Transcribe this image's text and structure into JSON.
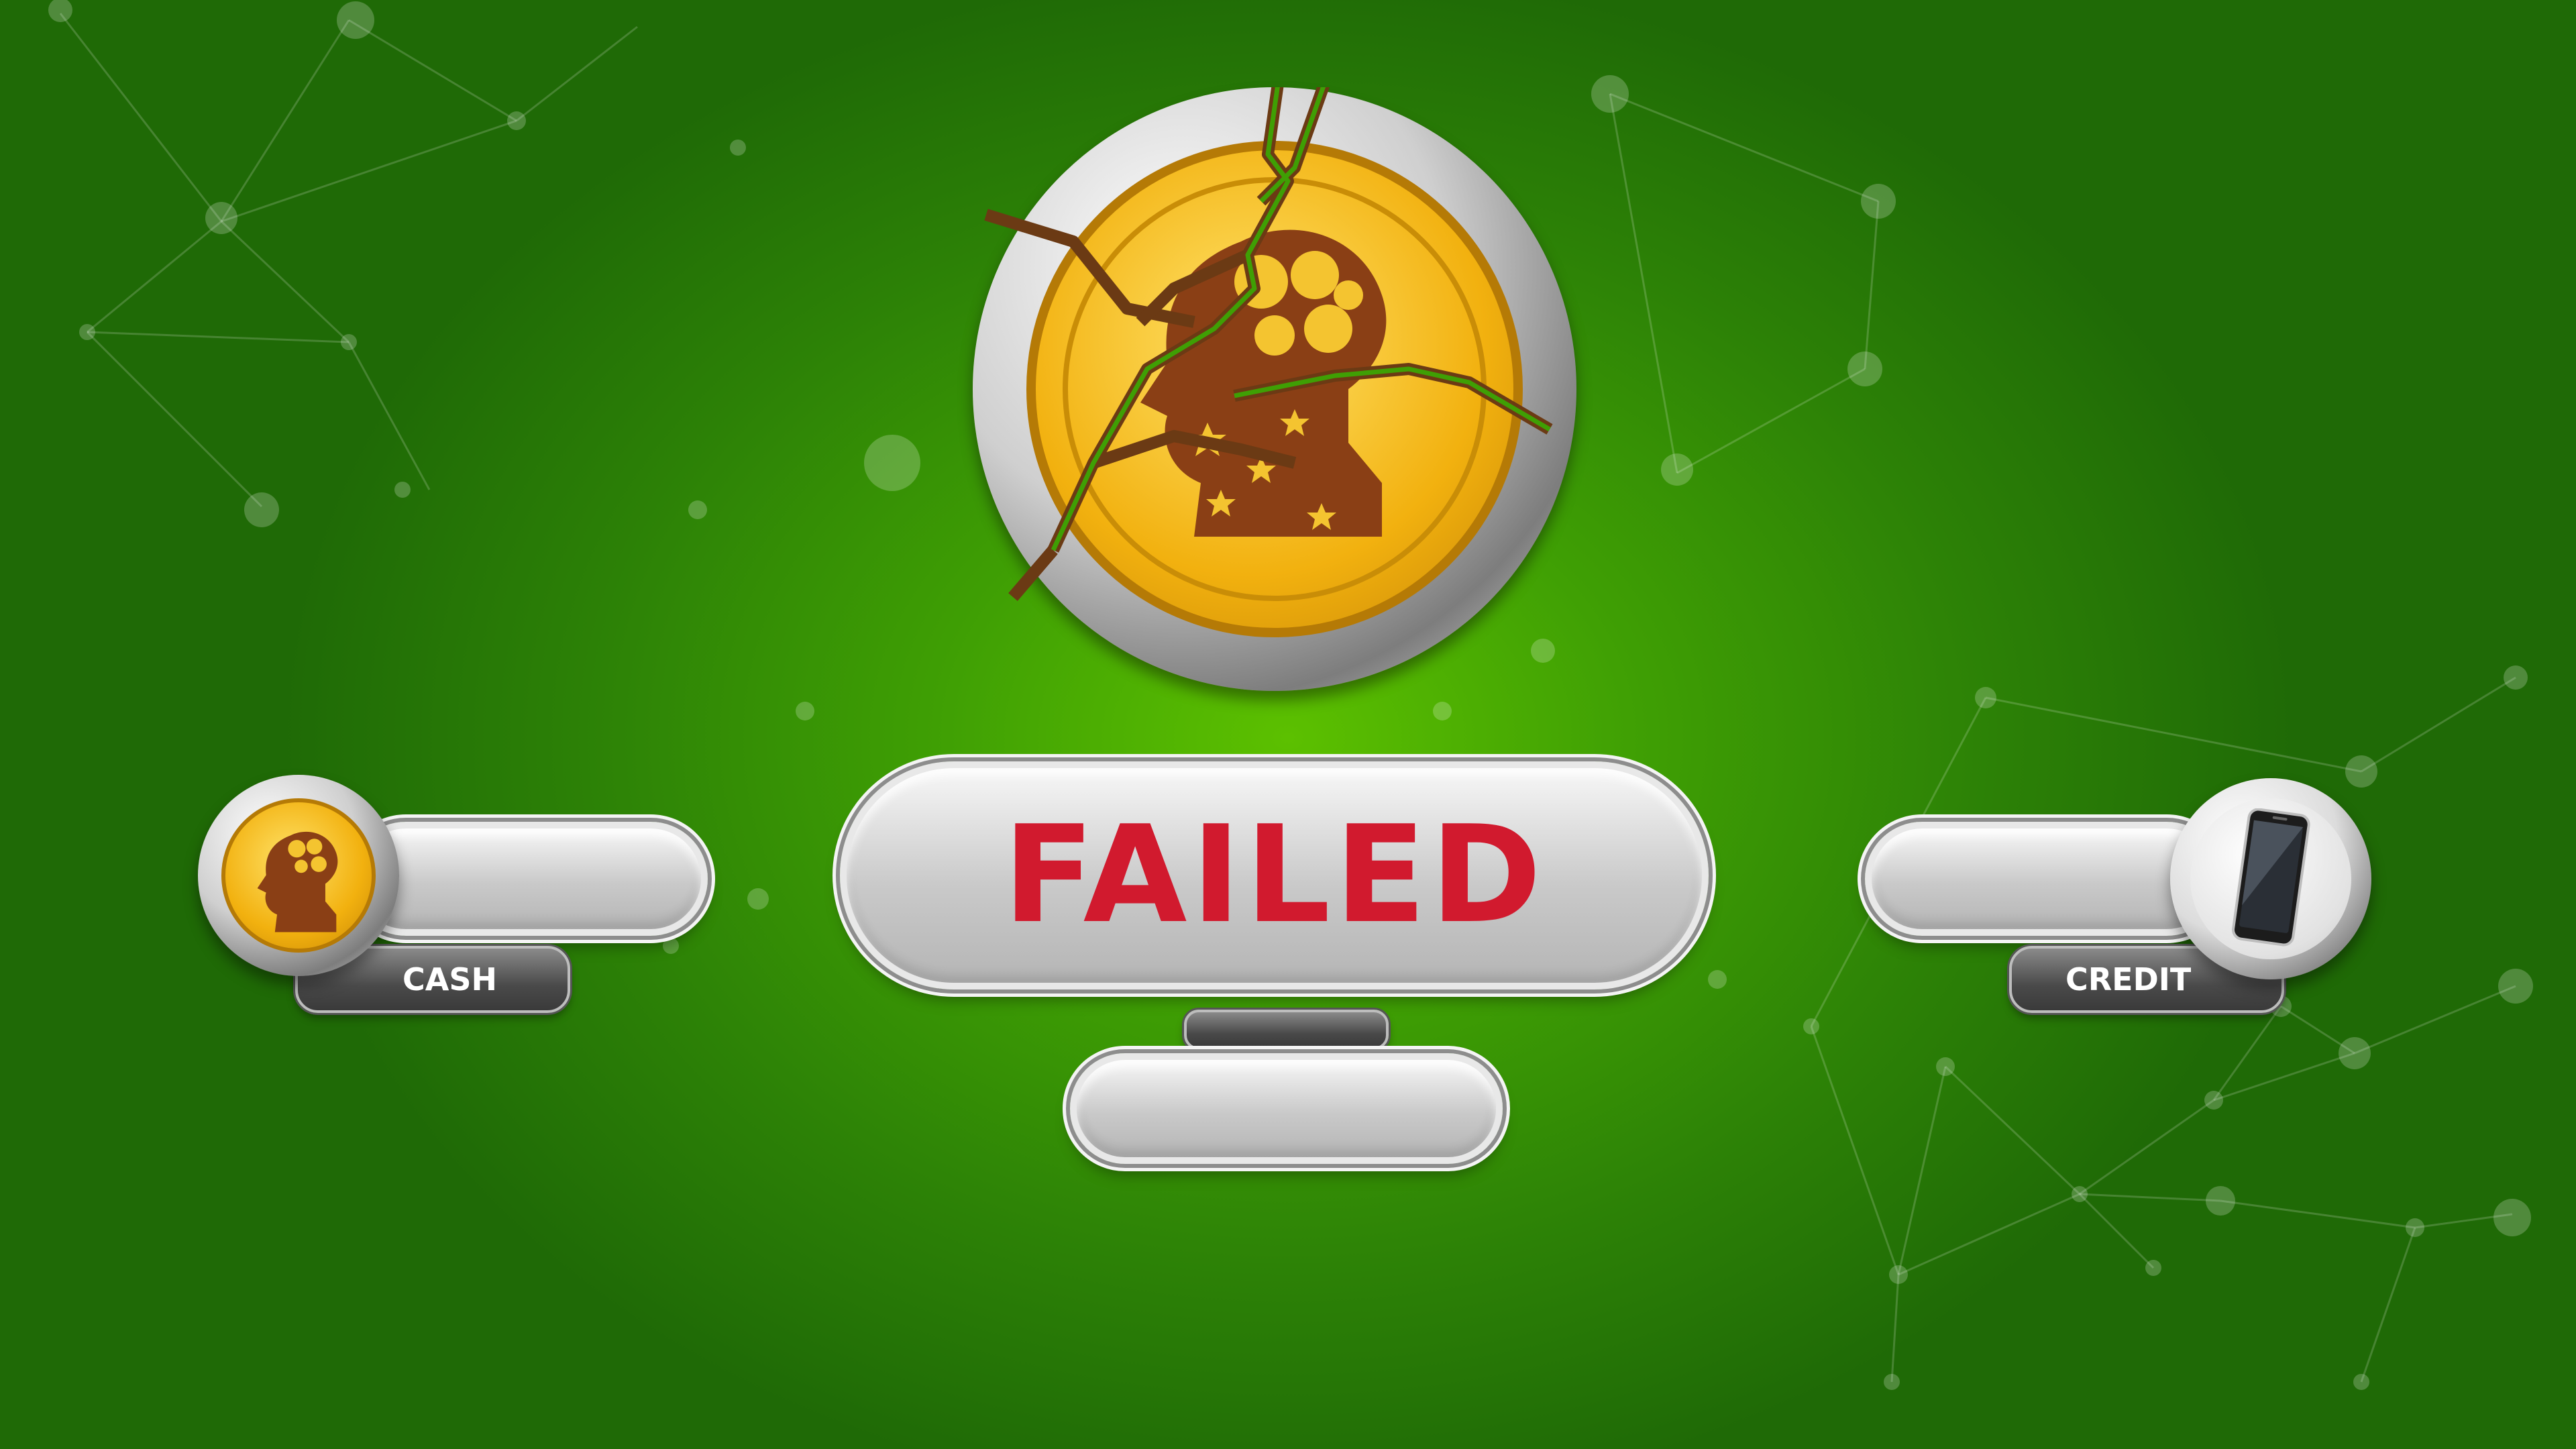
{
  "result": {
    "status_text": "FAILED",
    "status_color": "#d11a2e"
  },
  "cash": {
    "label": "CASH",
    "icon": "coin-brain-icon"
  },
  "credit": {
    "label": "CREDIT",
    "icon": "smartphone-icon"
  },
  "main_icon": "broken-coin-icon",
  "colors": {
    "background": "#3f9f04",
    "coin_gold": "#f2b10f",
    "crack": "#6b3a14"
  }
}
